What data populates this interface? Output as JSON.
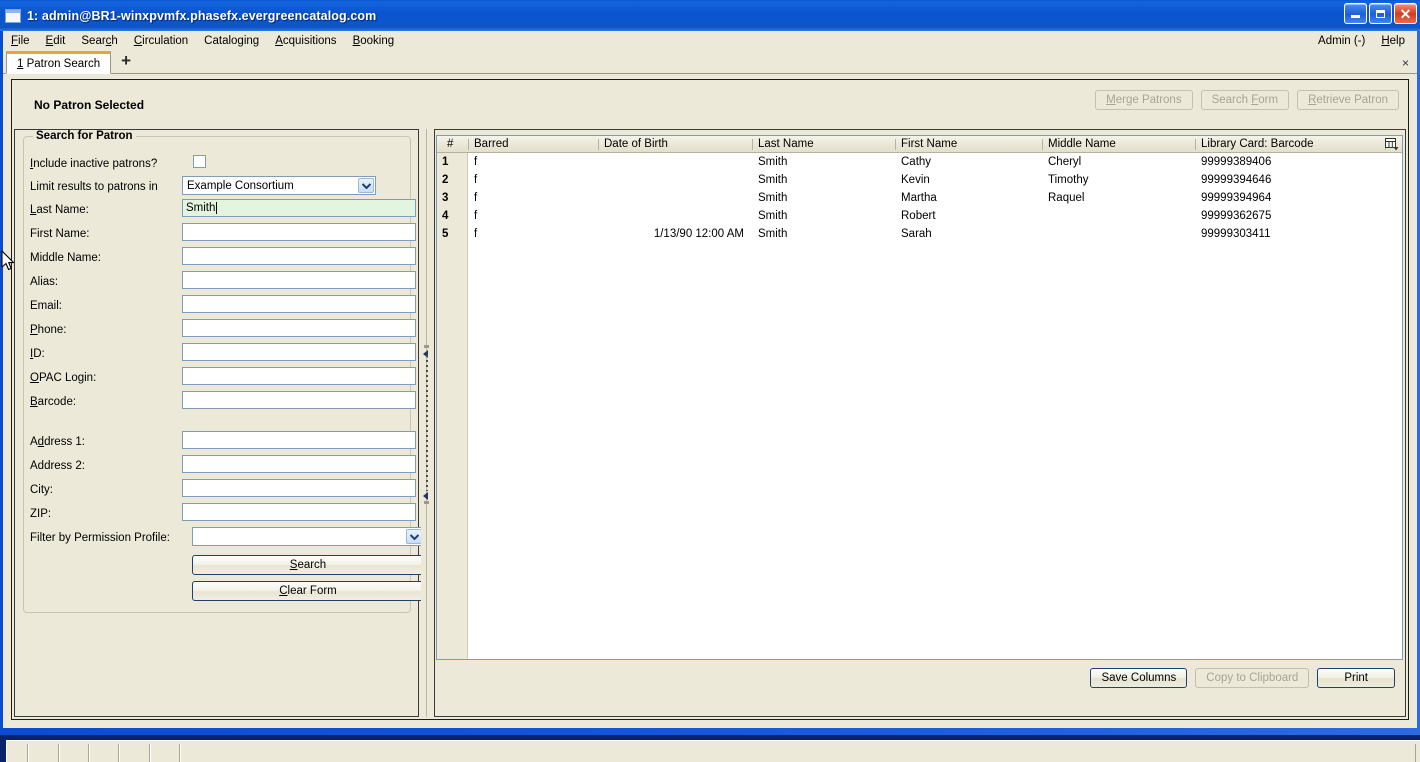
{
  "window": {
    "title": "1: admin@BR1-winxpvmfx.phasefx.evergreencatalog.com",
    "icon": "window-icon",
    "minimize_label": "Minimize",
    "maximize_label": "Maximize",
    "close_label": "Close"
  },
  "menubar": {
    "items": [
      {
        "label": "File",
        "accel": "F"
      },
      {
        "label": "Edit",
        "accel": "E"
      },
      {
        "label": "Search",
        "accel": "c"
      },
      {
        "label": "Circulation",
        "accel": "C"
      },
      {
        "label": "Cataloging",
        "accel": "g"
      },
      {
        "label": "Acquisitions",
        "accel": "A"
      },
      {
        "label": "Booking",
        "accel": "B"
      }
    ],
    "right_items": [
      {
        "label": "Admin (-)",
        "accel": ""
      },
      {
        "label": "Help",
        "accel": "H"
      }
    ]
  },
  "tabs": {
    "items": [
      {
        "number": "1",
        "label": "Patron Search"
      }
    ],
    "new_tab_label": "+",
    "close_label": "×"
  },
  "patron_bar": {
    "status": "No Patron Selected",
    "buttons": [
      {
        "label": "Merge Patrons",
        "accel": "M",
        "disabled": true
      },
      {
        "label": "Search Form",
        "accel": "F",
        "disabled": true
      },
      {
        "label": "Retrieve Patron",
        "accel": "R",
        "disabled": true
      }
    ]
  },
  "search_form": {
    "legend": "Search for Patron",
    "include_inactive": {
      "label": "Include inactive patrons?",
      "accel": "I",
      "checked": false
    },
    "limit_results": {
      "label": "Limit results to patrons in",
      "value": "Example Consortium"
    },
    "fields": [
      {
        "label": "Last Name:",
        "accel": "L",
        "value": "Smith",
        "focused": true
      },
      {
        "label": "First Name:",
        "accel": "",
        "value": "",
        "focused": false
      },
      {
        "label": "Middle Name:",
        "accel": "",
        "value": "",
        "focused": false
      },
      {
        "label": "Alias:",
        "accel": "",
        "value": "",
        "focused": false
      },
      {
        "label": "Email:",
        "accel": "",
        "value": "",
        "focused": false
      },
      {
        "label": "Phone:",
        "accel": "P",
        "value": "",
        "focused": false
      },
      {
        "label": "ID:",
        "accel": "I",
        "value": "",
        "focused": false
      },
      {
        "label": "OPAC Login:",
        "accel": "O",
        "value": "",
        "focused": false
      },
      {
        "label": "Barcode:",
        "accel": "B",
        "value": "",
        "focused": false
      }
    ],
    "address_fields": [
      {
        "label": "Address 1:",
        "accel": "d",
        "value": ""
      },
      {
        "label": "Address 2:",
        "accel": "",
        "value": ""
      },
      {
        "label": "City:",
        "accel": "",
        "value": ""
      },
      {
        "label": "ZIP:",
        "accel": "",
        "value": ""
      }
    ],
    "permission_profile": {
      "label": "Filter by Permission Profile:",
      "value": ""
    },
    "search_button": {
      "label": "Search",
      "accel": "S"
    },
    "clear_button": {
      "label": "Clear Form",
      "accel": "C"
    }
  },
  "results": {
    "columns": [
      {
        "key": "num",
        "label": "#"
      },
      {
        "key": "barred",
        "label": "Barred"
      },
      {
        "key": "dob",
        "label": "Date of Birth"
      },
      {
        "key": "last",
        "label": "Last Name"
      },
      {
        "key": "first",
        "label": "First Name"
      },
      {
        "key": "middle",
        "label": "Middle Name"
      },
      {
        "key": "barcode",
        "label": "Library Card: Barcode"
      }
    ],
    "column_picker_icon": "column-picker-icon",
    "rows": [
      {
        "num": "1",
        "barred": "f",
        "dob": "",
        "last": "Smith",
        "first": "Cathy",
        "middle": "Cheryl",
        "barcode": "99999389406"
      },
      {
        "num": "2",
        "barred": "f",
        "dob": "",
        "last": "Smith",
        "first": "Kevin",
        "middle": "Timothy",
        "barcode": "99999394646"
      },
      {
        "num": "3",
        "barred": "f",
        "dob": "",
        "last": "Smith",
        "first": "Martha",
        "middle": "Raquel",
        "barcode": "99999394964"
      },
      {
        "num": "4",
        "barred": "f",
        "dob": "",
        "last": "Smith",
        "first": "Robert",
        "middle": "",
        "barcode": "99999362675"
      },
      {
        "num": "5",
        "barred": "f",
        "dob": "1/13/90 12:00 AM",
        "last": "Smith",
        "first": "Sarah",
        "middle": "",
        "barcode": "99999303411"
      }
    ],
    "buttons": [
      {
        "label": "Save Columns",
        "disabled": false
      },
      {
        "label": "Copy to Clipboard",
        "disabled": true
      },
      {
        "label": "Print",
        "disabled": false
      }
    ]
  },
  "statusbar": {
    "segments": [
      "",
      "",
      "",
      "",
      "",
      "",
      ""
    ]
  },
  "colors": {
    "titlebar_blue": "#0a55cf",
    "face": "#ece9d8",
    "field_focus_green": "#e3f4df",
    "tab_accent": "#e8a33d",
    "button_border": "#22406b",
    "field_border": "#7f9db9"
  }
}
